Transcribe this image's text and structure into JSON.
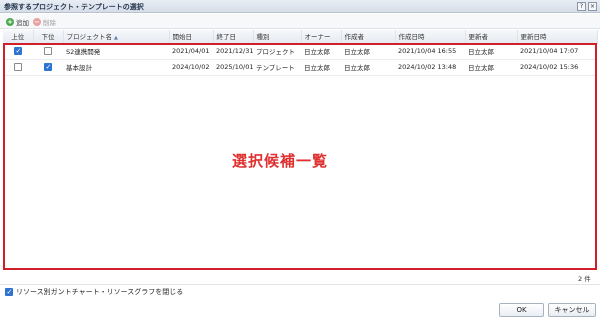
{
  "window": {
    "title": "参照するプロジェクト・テンプレートの選択",
    "help_label": "?",
    "close_label": "×"
  },
  "toolbar": {
    "add_label": "追加",
    "delete_label": "削除",
    "add_icon": "add-icon",
    "delete_icon": "delete-icon"
  },
  "grid": {
    "columns": [
      "上位",
      "下位",
      "プロジェクト名",
      "開始日",
      "終了日",
      "種別",
      "オーナー",
      "作成者",
      "作成日時",
      "更新者",
      "更新日時"
    ],
    "rows": [
      {
        "upper_checked": true,
        "lower_checked": false,
        "name": "S2連携開発",
        "start": "2021/04/01",
        "end": "2021/12/31",
        "type": "プロジェクト",
        "owner": "日立太郎",
        "creator": "日立太郎",
        "created": "2021/10/04 16:55",
        "updater": "日立太郎",
        "updated": "2021/10/04 17:07"
      },
      {
        "upper_checked": false,
        "lower_checked": true,
        "name": "基本設計",
        "start": "2024/10/02",
        "end": "2025/10/01",
        "type": "テンプレート",
        "owner": "日立太郎",
        "creator": "日立太郎",
        "created": "2024/10/02 13:48",
        "updater": "日立太郎",
        "updated": "2024/10/02 15:36"
      }
    ],
    "sorted_column": "プロジェクト名",
    "sort_direction": "ascending"
  },
  "annotation": {
    "label": "選択候補一覧",
    "color": "#d11f2a"
  },
  "status": {
    "count": "2 件"
  },
  "footer": {
    "close_option_label": "リソース別ガントチャート・リソースグラフを閉じる",
    "close_option_checked": true,
    "ok_label": "OK",
    "cancel_label": "キャンセル"
  }
}
